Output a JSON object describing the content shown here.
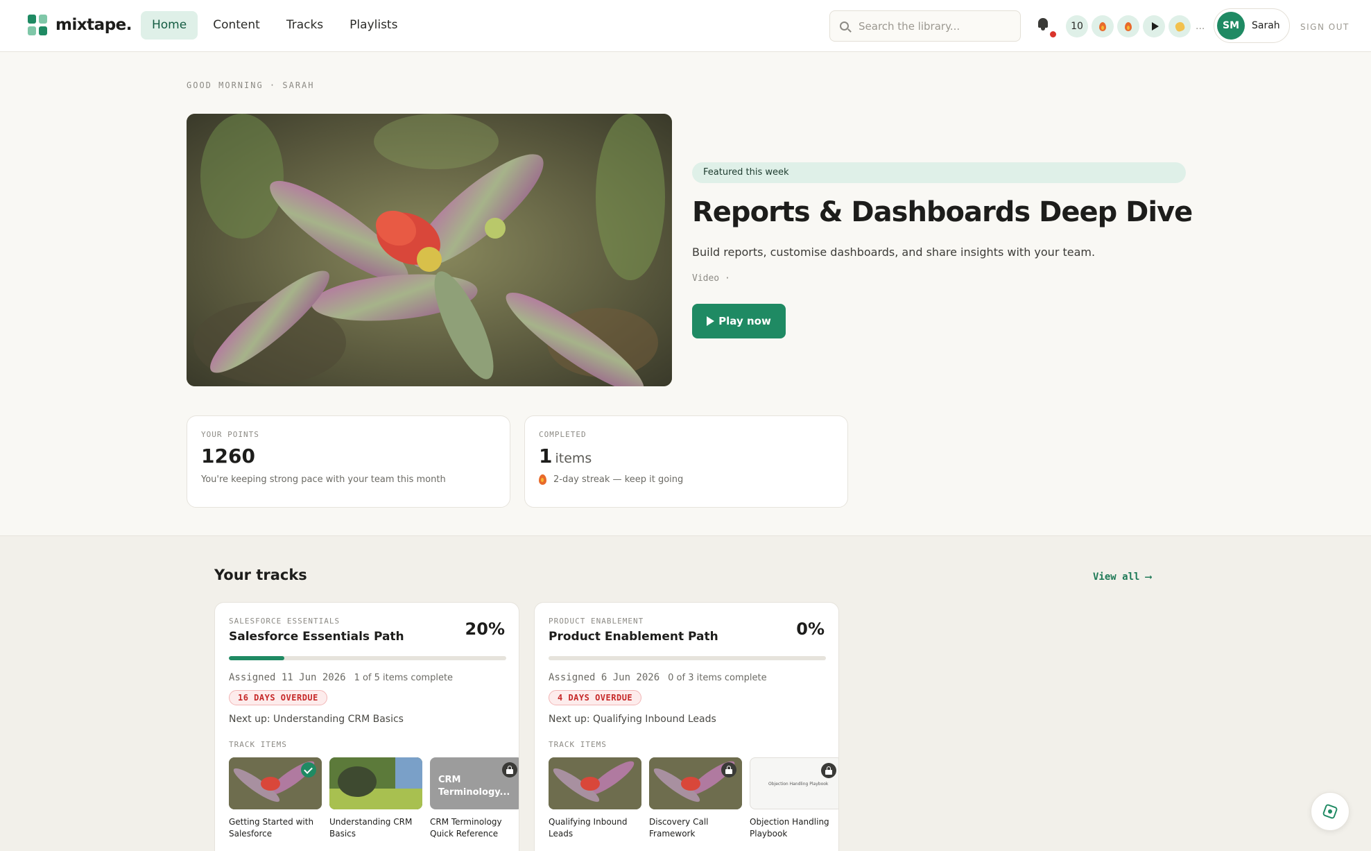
{
  "app": {
    "name": "mixtape."
  },
  "nav": {
    "items": [
      {
        "label": "Home",
        "active": true
      },
      {
        "label": "Content",
        "active": false
      },
      {
        "label": "Tracks",
        "active": false
      },
      {
        "label": "Playlists",
        "active": false
      }
    ]
  },
  "search": {
    "placeholder": "Search the library...",
    "value": ""
  },
  "header": {
    "notifications_icon": "bell-icon",
    "points_badge": "10",
    "badge_icons": [
      "flame-icon",
      "flame-icon",
      "play-icon",
      "clap-icon"
    ],
    "more": "...",
    "user_initials": "SM",
    "user_name": "Sarah",
    "signout_label": "SIGN OUT"
  },
  "hero": {
    "greeting": "GOOD MORNING · SARAH",
    "featured_label": "Featured this week",
    "title": "Reports & Dashboards Deep Dive",
    "description": "Build reports, customise dashboards, and share insights with your team.",
    "meta": "Video ·",
    "play_label": "Play now"
  },
  "stats": {
    "points": {
      "label": "YOUR POINTS",
      "value": "1260",
      "note": "You're keeping strong pace with your team this month"
    },
    "completed": {
      "label": "COMPLETED",
      "value": "1",
      "unit": "items",
      "note": "2-day streak — keep it going"
    }
  },
  "tracks_section": {
    "title": "Your tracks",
    "view_all_label": "View all ⟶"
  },
  "tracks": [
    {
      "category": "SALESFORCE ESSENTIALS",
      "name": "Salesforce Essentials Path",
      "percent_label": "20%",
      "progress": 0.2,
      "assigned": "Assigned 11 Jun 2026",
      "items_complete": "1 of 5 items complete",
      "overdue": "16 DAYS OVERDUE",
      "next_up": "Next up: Understanding CRM Basics",
      "items_label": "TRACK ITEMS",
      "items": [
        {
          "title": "Getting Started with Salesforce",
          "status": "complete"
        },
        {
          "title": "Understanding CRM Basics",
          "status": "none"
        },
        {
          "title": "CRM Terminology Quick Reference",
          "status": "locked",
          "overlay": "CRM Terminology..."
        }
      ]
    },
    {
      "category": "PRODUCT ENABLEMENT",
      "name": "Product Enablement Path",
      "percent_label": "0%",
      "progress": 0,
      "assigned": "Assigned 6 Jun 2026",
      "items_complete": "0 of 3 items complete",
      "overdue": "4 DAYS OVERDUE",
      "next_up": "Next up: Qualifying Inbound Leads",
      "items_label": "TRACK ITEMS",
      "items": [
        {
          "title": "Qualifying Inbound Leads",
          "status": "none"
        },
        {
          "title": "Discovery Call Framework",
          "status": "locked"
        },
        {
          "title": "Objection Handling Playbook",
          "status": "locked",
          "overlay": "Objection Handling Playbook"
        }
      ]
    }
  ],
  "colors": {
    "brand": "#1f8a63",
    "brand_light": "#dff0e8",
    "danger": "#c62828"
  }
}
